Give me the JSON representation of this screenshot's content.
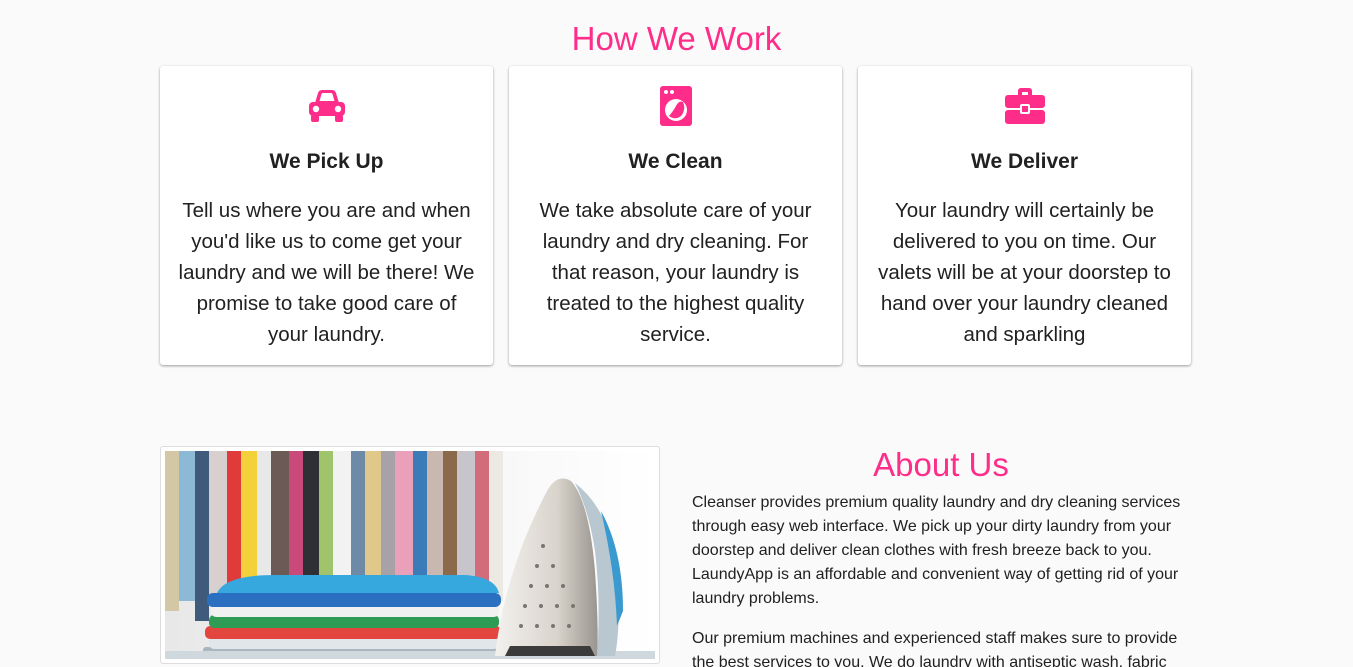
{
  "how_we_work": {
    "title": "How We Work",
    "cards": [
      {
        "icon": "car-icon",
        "heading": "We Pick Up",
        "text": "Tell us where you are and when you'd like us to come get your laundry and we will be there! We promise to take good care of your laundry."
      },
      {
        "icon": "washing-machine-icon",
        "heading": "We Clean",
        "text": "We take absolute care of your laundry and dry cleaning. For that reason, your laundry is treated to the highest quality service."
      },
      {
        "icon": "briefcase-icon",
        "heading": "We Deliver",
        "text": "Your laundry will certainly be delivered to you on time. Our valets will be at your doorstep to hand over your laundry cleaned and sparkling"
      }
    ]
  },
  "about": {
    "title": "About Us",
    "image": "laundry-clothes-and-iron-image",
    "paragraphs": [
      "Cleanser provides premium quality laundry and dry cleaning services through easy web interface. We pick up your dirty laundry from your doorstep and deliver clean clothes with fresh breeze back to you. LaundyApp is an affordable and convenient way of getting rid of your laundry problems.",
      "Our premium machines and experienced staff makes sure to provide the best services to you. We do laundry with antiseptic wash, fabric"
    ]
  },
  "colors": {
    "accent": "#ff2d8a",
    "text": "#212121",
    "background": "#fafafa",
    "card": "#ffffff"
  }
}
